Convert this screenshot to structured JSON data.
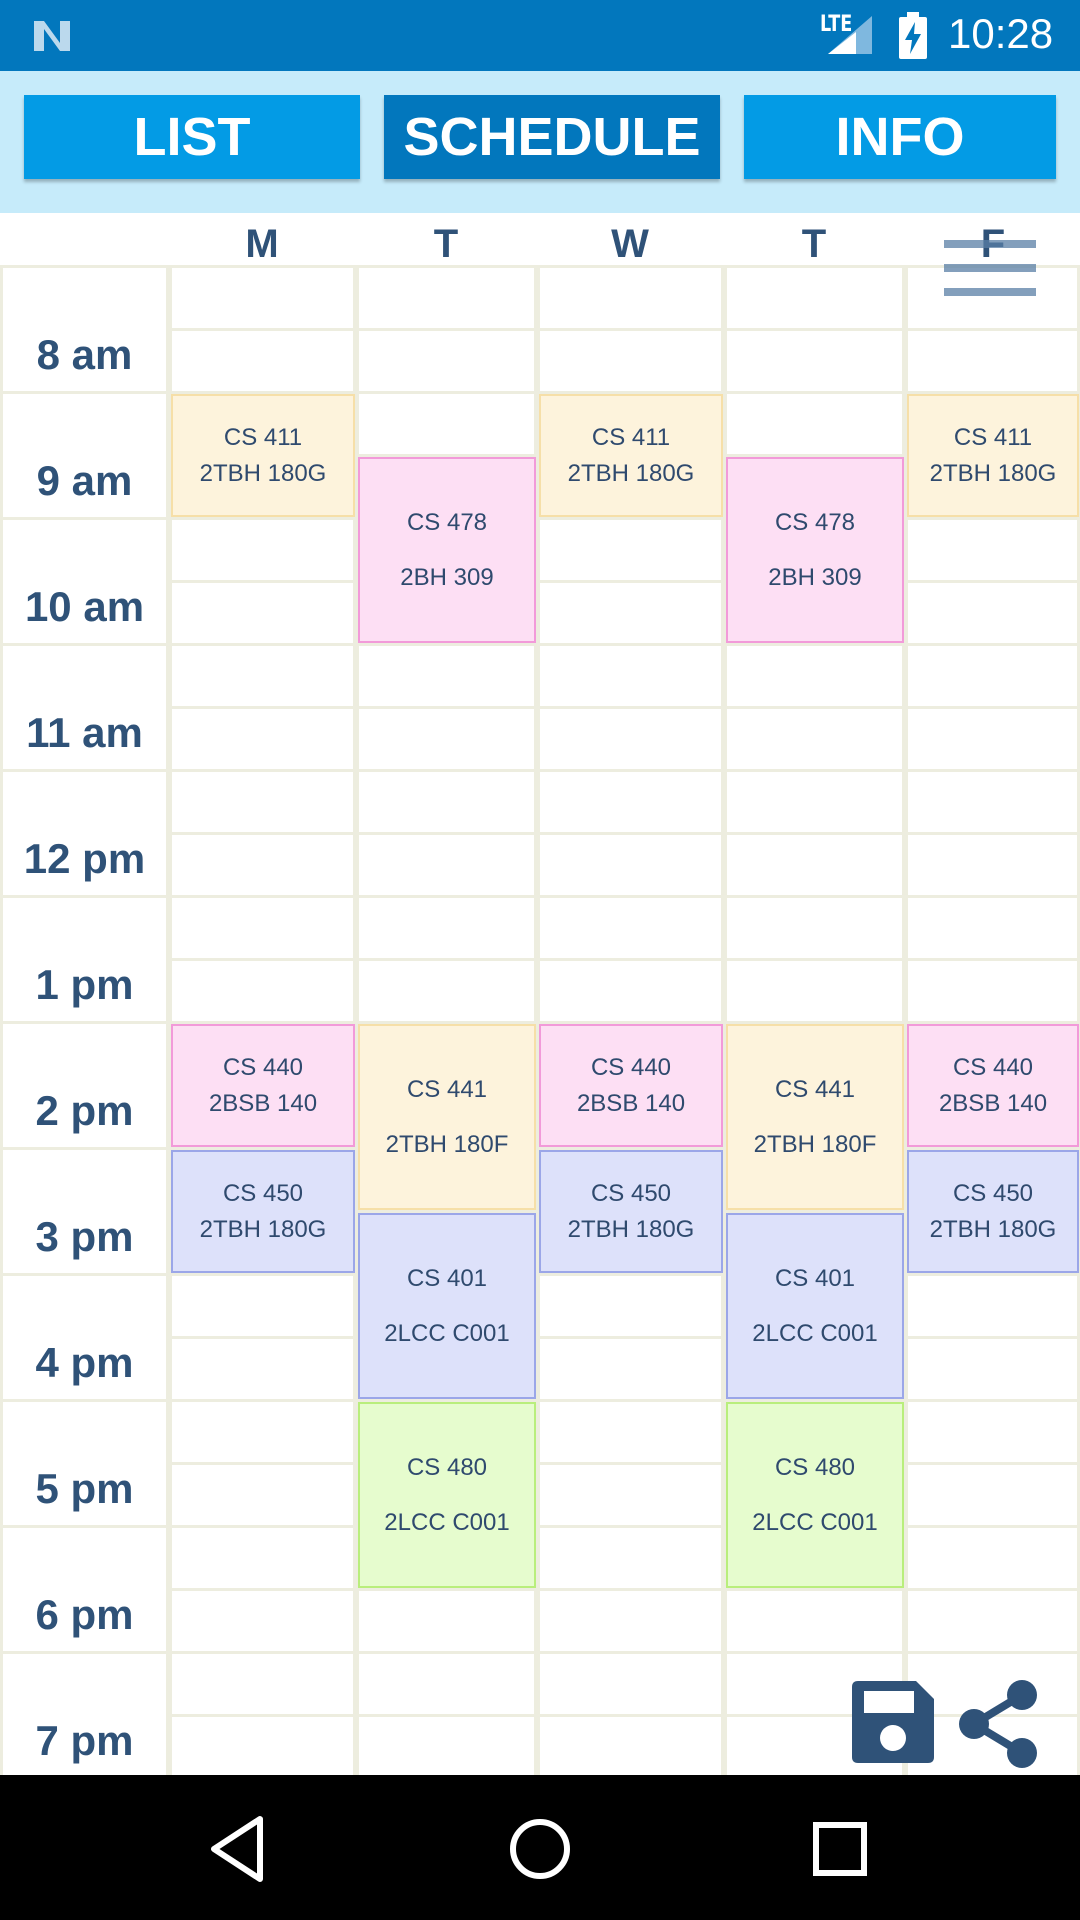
{
  "status_bar": {
    "network": "LTE",
    "time": "10:28"
  },
  "tabs": [
    {
      "label": "LIST",
      "active": false
    },
    {
      "label": "SCHEDULE",
      "active": true
    },
    {
      "label": "INFO",
      "active": false
    }
  ],
  "days": [
    "M",
    "T",
    "W",
    "T",
    "F"
  ],
  "hours": [
    "8 am",
    "9 am",
    "10 am",
    "11 am",
    "12 pm",
    "1 pm",
    "2 pm",
    "3 pm",
    "4 pm",
    "5 pm",
    "6 pm",
    "7 pm"
  ],
  "classes": [
    {
      "day": 0,
      "start": 9,
      "end": 10,
      "course": "CS 411",
      "room": "2TBH 180G",
      "color": "#fdf3dc"
    },
    {
      "day": 2,
      "start": 9,
      "end": 10,
      "course": "CS 411",
      "room": "2TBH 180G",
      "color": "#fdf3dc"
    },
    {
      "day": 4,
      "start": 9,
      "end": 10,
      "course": "CS 411",
      "room": "2TBH 180G",
      "color": "#fdf3dc"
    },
    {
      "day": 1,
      "start": 9.5,
      "end": 11,
      "course": "CS 478",
      "room": "2BH 309",
      "color": "#fddff4"
    },
    {
      "day": 3,
      "start": 9.5,
      "end": 11,
      "course": "CS 478",
      "room": "2BH 309",
      "color": "#fddff4"
    },
    {
      "day": 0,
      "start": 14,
      "end": 15,
      "course": "CS 440",
      "room": "2BSB 140",
      "color": "#fddff4"
    },
    {
      "day": 2,
      "start": 14,
      "end": 15,
      "course": "CS 440",
      "room": "2BSB 140",
      "color": "#fddff4"
    },
    {
      "day": 4,
      "start": 14,
      "end": 15,
      "course": "CS 440",
      "room": "2BSB 140",
      "color": "#fddff4"
    },
    {
      "day": 1,
      "start": 14,
      "end": 15.5,
      "course": "CS 441",
      "room": "2TBH 180F",
      "color": "#fdf3dc"
    },
    {
      "day": 3,
      "start": 14,
      "end": 15.5,
      "course": "CS 441",
      "room": "2TBH 180F",
      "color": "#fdf3dc"
    },
    {
      "day": 0,
      "start": 15,
      "end": 16,
      "course": "CS 450",
      "room": "2TBH 180G",
      "color": "#dde1fa"
    },
    {
      "day": 2,
      "start": 15,
      "end": 16,
      "course": "CS 450",
      "room": "2TBH 180G",
      "color": "#dde1fa"
    },
    {
      "day": 4,
      "start": 15,
      "end": 16,
      "course": "CS 450",
      "room": "2TBH 180G",
      "color": "#dde1fa"
    },
    {
      "day": 1,
      "start": 15.5,
      "end": 17,
      "course": "CS 401",
      "room": "2LCC C001",
      "color": "#dde1fa"
    },
    {
      "day": 3,
      "start": 15.5,
      "end": 17,
      "course": "CS 401",
      "room": "2LCC C001",
      "color": "#dde1fa"
    },
    {
      "day": 1,
      "start": 17,
      "end": 18.5,
      "course": "CS 480",
      "room": "2LCC C001",
      "color": "#e6fcce"
    },
    {
      "day": 3,
      "start": 17,
      "end": 18.5,
      "course": "CS 480",
      "room": "2LCC C001",
      "color": "#e6fcce"
    }
  ],
  "colors": {
    "status_bar": "#0277bd",
    "tab": "#039be5",
    "tab_active": "#0277bd",
    "tab_area": "#c6ebfa",
    "label_text": "#2f5278"
  },
  "icons": {
    "menu": "hamburger-menu-icon",
    "save": "floppy-disk-icon",
    "share": "share-icon",
    "back": "back-triangle-icon",
    "home": "home-circle-icon",
    "recents": "recents-square-icon"
  }
}
